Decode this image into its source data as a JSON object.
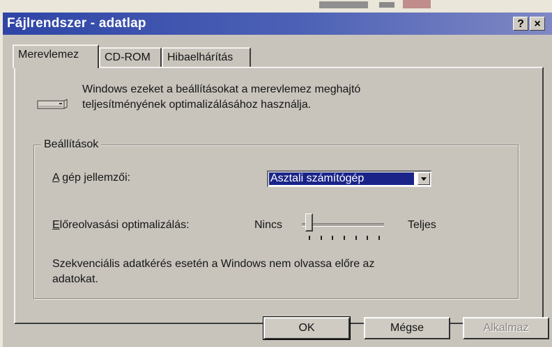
{
  "window": {
    "title": "Fájlrendszer - adatlap",
    "help_glyph": "?",
    "close_glyph": "×"
  },
  "tabs": [
    {
      "label": "Merevlemez",
      "active": true
    },
    {
      "label": "CD-ROM",
      "active": false
    },
    {
      "label": "Hibaelhárítás",
      "active": false
    }
  ],
  "intro": {
    "line1": "Windows ezeket a beállításokat a merevlemez meghajtó",
    "line2": "teljesítményének optimalizálásához használja."
  },
  "settings": {
    "legend": "Beállítások",
    "machine": {
      "label_key": "A",
      "label_rest": " gép jellemzői:",
      "selected": "Asztali számítógép"
    },
    "readahead": {
      "label_key": "E",
      "label_rest": "lőreolvasási optimalizálás:",
      "min_label": "Nincs",
      "max_label": "Teljes",
      "position": 0,
      "ticks": 7
    },
    "description_line1": "Szekvenciális adatkérés esetén a Windows nem olvassa előre az",
    "description_line2": "adatokat."
  },
  "buttons": {
    "ok": "OK",
    "cancel": "Mégse",
    "apply": "Alkalmaz"
  },
  "colors": {
    "title_bar": "#2f45a6",
    "selection": "#1a2488",
    "face": "#c8c4bc"
  }
}
